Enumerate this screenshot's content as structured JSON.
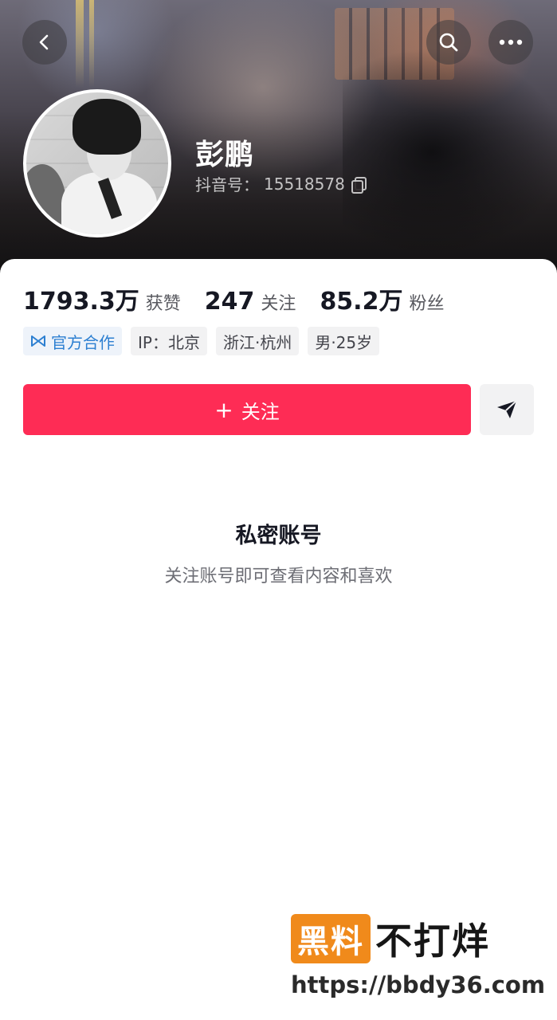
{
  "header": {
    "name": "彭鹏",
    "douyin_id_label": "抖音号：",
    "douyin_id": "15518578"
  },
  "stats": [
    {
      "value": "1793.3万",
      "label": "获赞"
    },
    {
      "value": "247",
      "label": "关注"
    },
    {
      "value": "85.2万",
      "label": "粉丝"
    }
  ],
  "tags": {
    "official": "官方合作",
    "ip": "IP：北京",
    "location": "浙江·杭州",
    "gender_age": "男·25岁"
  },
  "actions": {
    "follow_plus": "+",
    "follow_label": "关注"
  },
  "private": {
    "title": "私密账号",
    "subtitle": "关注账号即可查看内容和喜欢"
  },
  "watermark": {
    "box": "黑料",
    "text": "不打烊",
    "url": "https://bbdy36.com"
  },
  "colors": {
    "follow_button": "#fe2c55",
    "official_tag": "#2c7fd1",
    "watermark_box": "#f08a1b"
  }
}
